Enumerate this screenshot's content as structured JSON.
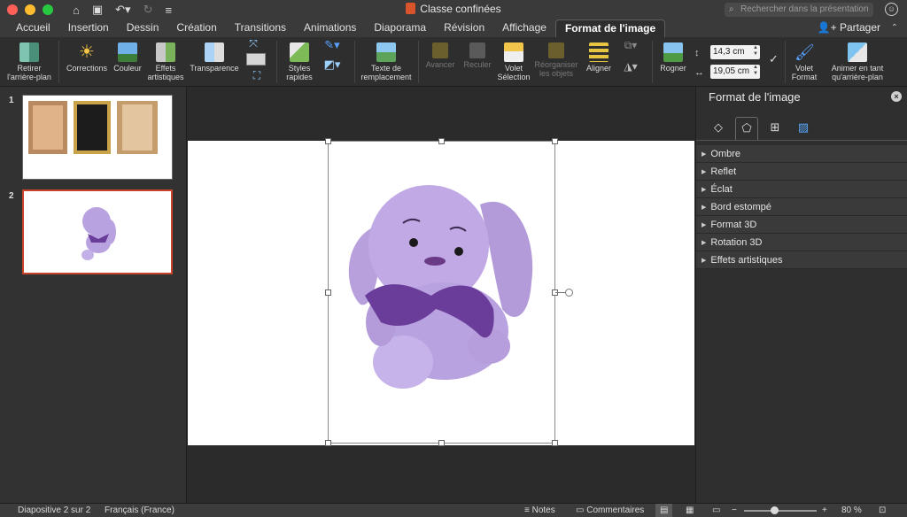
{
  "titlebar": {
    "doc_title": "Classe confinées",
    "search_placeholder": "Rechercher dans la présentation"
  },
  "tabs": [
    {
      "label": "Accueil"
    },
    {
      "label": "Insertion"
    },
    {
      "label": "Dessin"
    },
    {
      "label": "Création"
    },
    {
      "label": "Transitions"
    },
    {
      "label": "Animations"
    },
    {
      "label": "Diaporama"
    },
    {
      "label": "Révision"
    },
    {
      "label": "Affichage"
    },
    {
      "label": "Format de l'image",
      "active": true
    }
  ],
  "share_label": "Partager",
  "ribbon": {
    "remove_bg": [
      "Retirer",
      "l'arrière-plan"
    ],
    "corrections": "Corrections",
    "couleur": "Couleur",
    "effets": [
      "Effets",
      "artistiques"
    ],
    "transparence": "Transparence",
    "styles": [
      "Styles",
      "rapides"
    ],
    "texte_remplacement": [
      "Texte de",
      "remplacement"
    ],
    "avancer": "Avancer",
    "reculer": "Reculer",
    "volet_selection": [
      "Volet",
      "Sélection"
    ],
    "reorganiser": [
      "Réorganiser",
      "les objets"
    ],
    "aligner": "Aligner",
    "rogner": "Rogner",
    "height_value": "14,3 cm",
    "width_value": "19,05 cm",
    "volet_format": [
      "Volet",
      "Format"
    ],
    "animer": [
      "Animer en tant",
      "qu'arrière-plan"
    ]
  },
  "slides": [
    {
      "number": "1"
    },
    {
      "number": "2",
      "selected": true
    }
  ],
  "format_pane": {
    "title": "Format de l'image",
    "sections": [
      "Ombre",
      "Reflet",
      "Éclat",
      "Bord estompé",
      "Format 3D",
      "Rotation 3D",
      "Effets artistiques"
    ]
  },
  "status": {
    "slide_info": "Diapositive 2 sur 2",
    "language": "Français (France)",
    "notes": "Notes",
    "comments": "Commentaires",
    "zoom": "80 %"
  },
  "colors": {
    "accent_tab": "#c9432a",
    "bunny": "#b9a2e0",
    "ribbon_bow": "#6a3d9a"
  }
}
